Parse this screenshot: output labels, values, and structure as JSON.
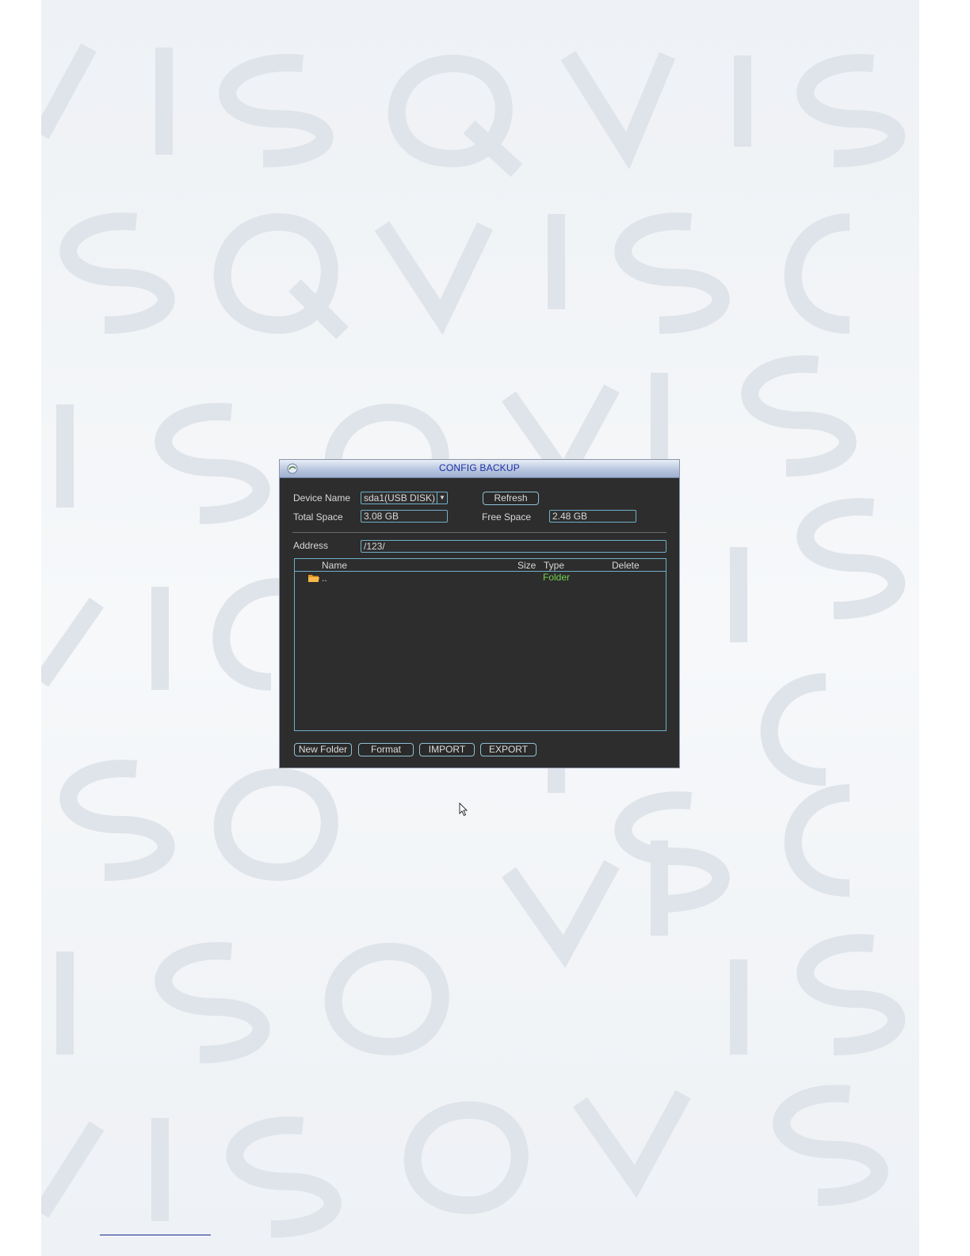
{
  "dialog": {
    "title": "CONFIG BACKUP",
    "device_name": {
      "label": "Device Name",
      "value": "sda1(USB DISK)"
    },
    "refresh_label": "Refresh",
    "total_space": {
      "label": "Total Space",
      "value": "3.08 GB"
    },
    "free_space": {
      "label": "Free Space",
      "value": "2.48 GB"
    },
    "address": {
      "label": "Address",
      "value": "/123/"
    },
    "file_list": {
      "columns": {
        "name": "Name",
        "size": "Size",
        "type": "Type",
        "delete": "Delete"
      },
      "rows": [
        {
          "name": "..",
          "size": "",
          "type": "Folder",
          "icon": "folder-icon"
        }
      ]
    },
    "buttons": {
      "new_folder": "New Folder",
      "format": "Format",
      "import": "IMPORT",
      "export": "EXPORT"
    }
  },
  "colors": {
    "dialog_bg": "#2d2d2d",
    "title_text": "#1a2fa8",
    "field_border": "#6fb0c8",
    "folder_type_text": "#6fd34c",
    "folder_icon": "#f0a830"
  }
}
